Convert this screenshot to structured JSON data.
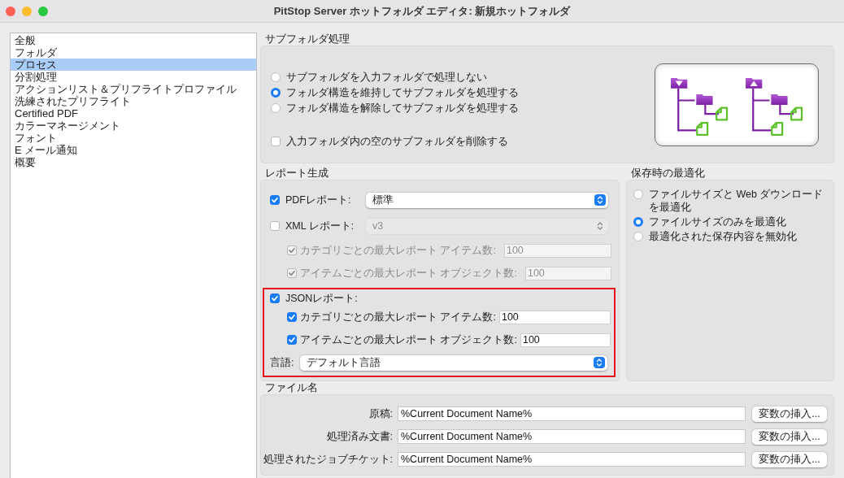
{
  "window": {
    "title": "PitStop Server ホットフォルダ エディタ: 新規ホットフォルダ"
  },
  "sidebar": {
    "items": [
      {
        "label": "全般",
        "selected": false
      },
      {
        "label": "フォルダ",
        "selected": false
      },
      {
        "label": "プロセス",
        "selected": true
      },
      {
        "label": "分割処理",
        "selected": false
      },
      {
        "label": "アクションリスト＆プリフライトプロファイル",
        "selected": false
      },
      {
        "label": "洗練されたプリフライト",
        "selected": false
      },
      {
        "label": "Certified PDF",
        "selected": false
      },
      {
        "label": "カラーマネージメント",
        "selected": false
      },
      {
        "label": "フォント",
        "selected": false
      },
      {
        "label": "E メール通知",
        "selected": false
      },
      {
        "label": "概要",
        "selected": false
      }
    ]
  },
  "subfolder": {
    "title": "サブフォルダ処理",
    "options": [
      {
        "label": "サブフォルダを入力フォルダで処理しない",
        "selected": false
      },
      {
        "label": "フォルダ構造を維持してサブフォルダを処理する",
        "selected": true
      },
      {
        "label": "フォルダ構造を解除してサブフォルダを処理する",
        "selected": false
      }
    ],
    "delete_empty": {
      "label": "入力フォルダ内の空のサブフォルダを削除する",
      "checked": false
    }
  },
  "report": {
    "title": "レポート生成",
    "sections": [
      {
        "rows": [
          {
            "kind": "toggle-select",
            "label": "PDFレポート:",
            "checked": true,
            "disabled": false,
            "value": "標準"
          },
          {
            "kind": "toggle-select",
            "label": "XML レポート:",
            "checked": false,
            "disabled": true,
            "value": "v3"
          },
          {
            "kind": "sub-number",
            "label": "カテゴリごとの最大レポート アイテム数:",
            "checked": true,
            "disabled": true,
            "value": "100"
          },
          {
            "kind": "sub-number",
            "label": "アイテムごとの最大レポート オブジェクト数:",
            "checked": true,
            "disabled": true,
            "value": "100"
          }
        ]
      },
      {
        "highlighted": true,
        "rows": [
          {
            "kind": "toggle",
            "label": "JSONレポート:",
            "checked": true
          },
          {
            "kind": "sub-number",
            "label": "カテゴリごとの最大レポート アイテム数:",
            "checked": true,
            "disabled": false,
            "value": "100"
          },
          {
            "kind": "sub-number",
            "label": "アイテムごとの最大レポート オブジェクト数:",
            "checked": true,
            "disabled": false,
            "value": "100"
          },
          {
            "kind": "select",
            "label": "言語:",
            "disabled": false,
            "value": "デフォルト言語"
          }
        ]
      }
    ]
  },
  "optimize": {
    "title": "保存時の最適化",
    "options": [
      {
        "label": "ファイルサイズと Web ダウンロードを最適化",
        "selected": false
      },
      {
        "label": "ファイルサイズのみを最適化",
        "selected": true
      },
      {
        "label": "最適化された保存内容を無効化",
        "selected": false
      }
    ]
  },
  "filename": {
    "title": "ファイル名",
    "rows": [
      {
        "label": "原稿:",
        "value": "%Current Document Name%",
        "button": "変数の挿入..."
      },
      {
        "label": "処理済み文書:",
        "value": "%Current Document Name%",
        "button": "変数の挿入..."
      },
      {
        "label": "処理されたジョブチケット:",
        "value": "%Current Document Name%",
        "button": "変数の挿入..."
      }
    ]
  }
}
